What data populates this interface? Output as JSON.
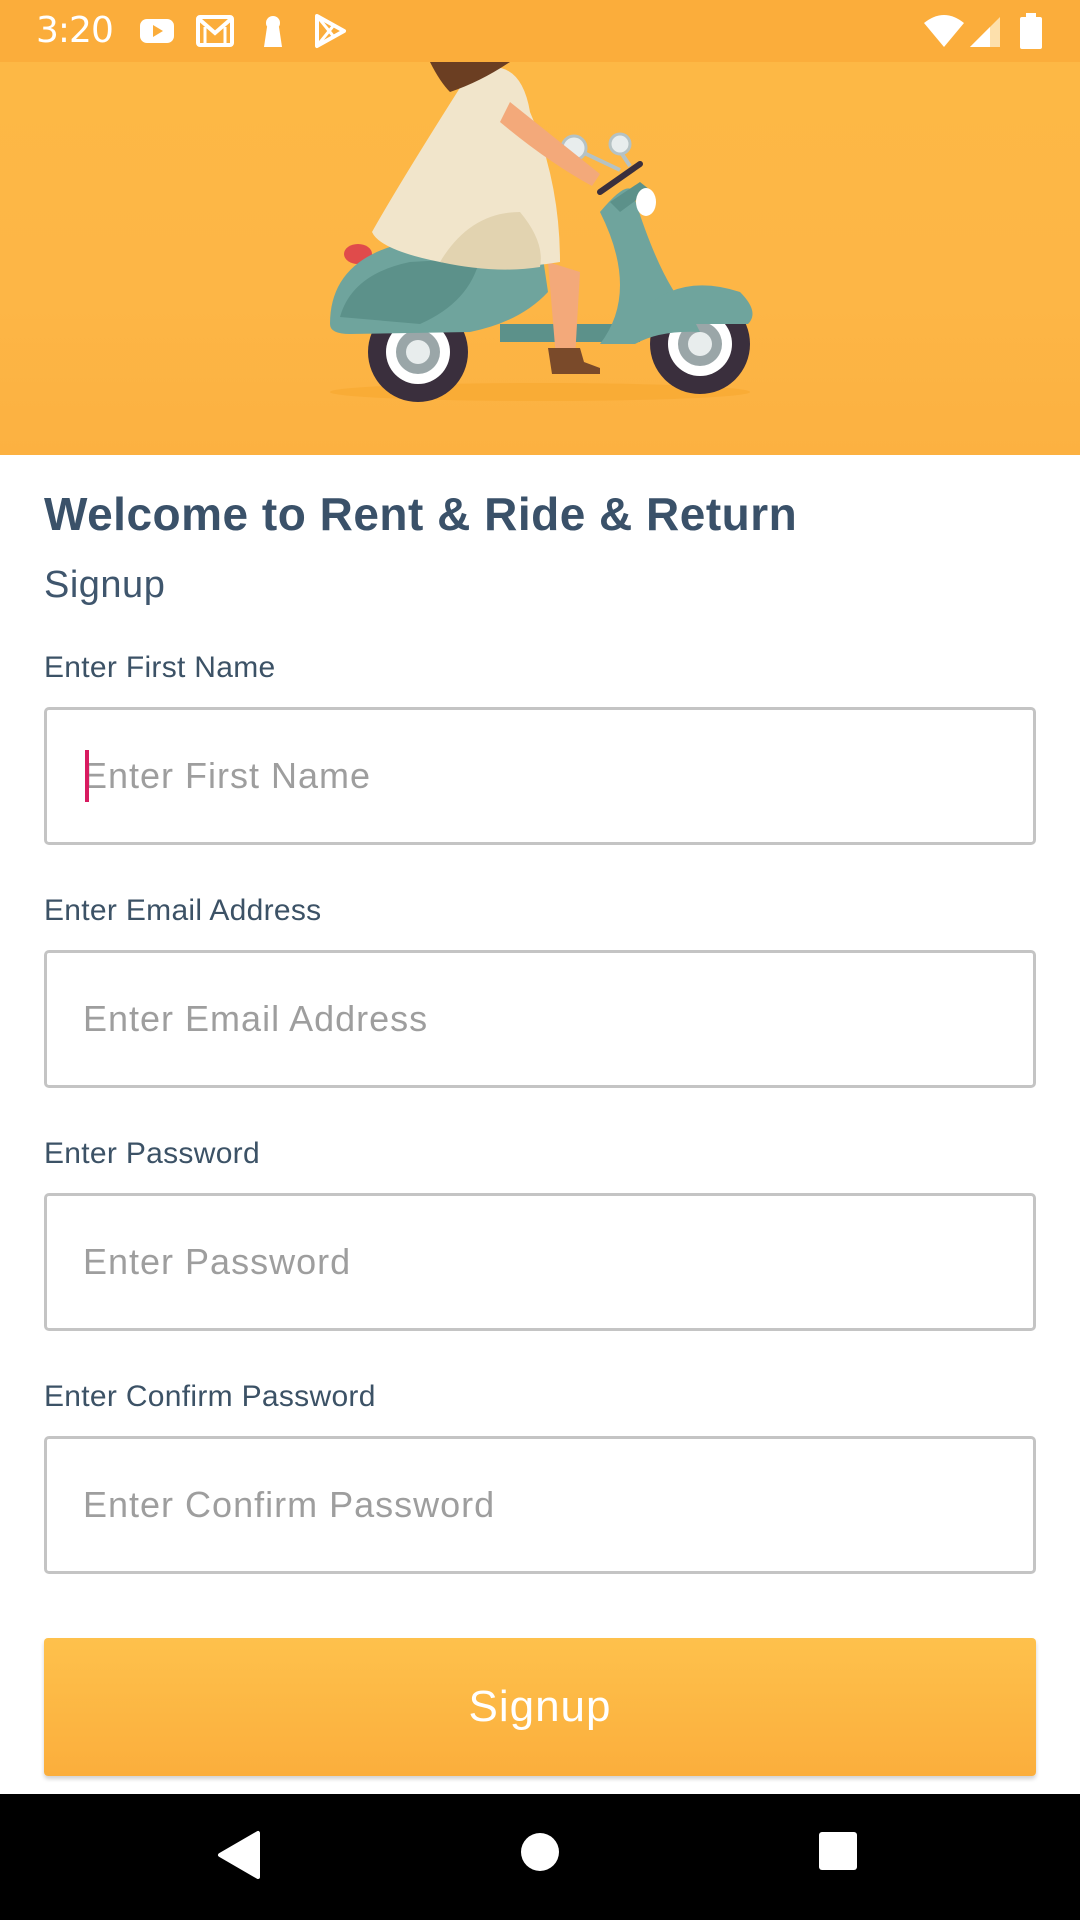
{
  "status_bar": {
    "time": "3:20",
    "left_icons": [
      "youtube-icon",
      "gmail-icon",
      "keyhole-icon",
      "play-store-icon"
    ],
    "right_icons": [
      "wifi-icon",
      "cell-signal-icon",
      "battery-icon"
    ]
  },
  "hero": {
    "illustration": "woman-riding-scooter-illustration",
    "background_color": "#fdb646"
  },
  "header": {
    "title": "Welcome to Rent & Ride & Return",
    "subtitle": "Signup"
  },
  "form": {
    "first_name": {
      "label": "Enter First Name",
      "placeholder": "Enter First Name",
      "value": ""
    },
    "email": {
      "label": "Enter Email Address",
      "placeholder": "Enter Email Address",
      "value": ""
    },
    "password": {
      "label": "Enter Password",
      "placeholder": "Enter Password",
      "value": ""
    },
    "confirm_password": {
      "label": "Enter Confirm Password",
      "placeholder": "Enter Confirm Password",
      "value": ""
    },
    "submit_label": "Signup"
  },
  "nav_bar": {
    "buttons": [
      "back-icon",
      "home-icon",
      "recents-icon"
    ]
  },
  "colors": {
    "accent": "#fbae3c",
    "text_primary": "#3a5169",
    "caret": "#d81b60",
    "input_border": "#c4c4c4"
  }
}
